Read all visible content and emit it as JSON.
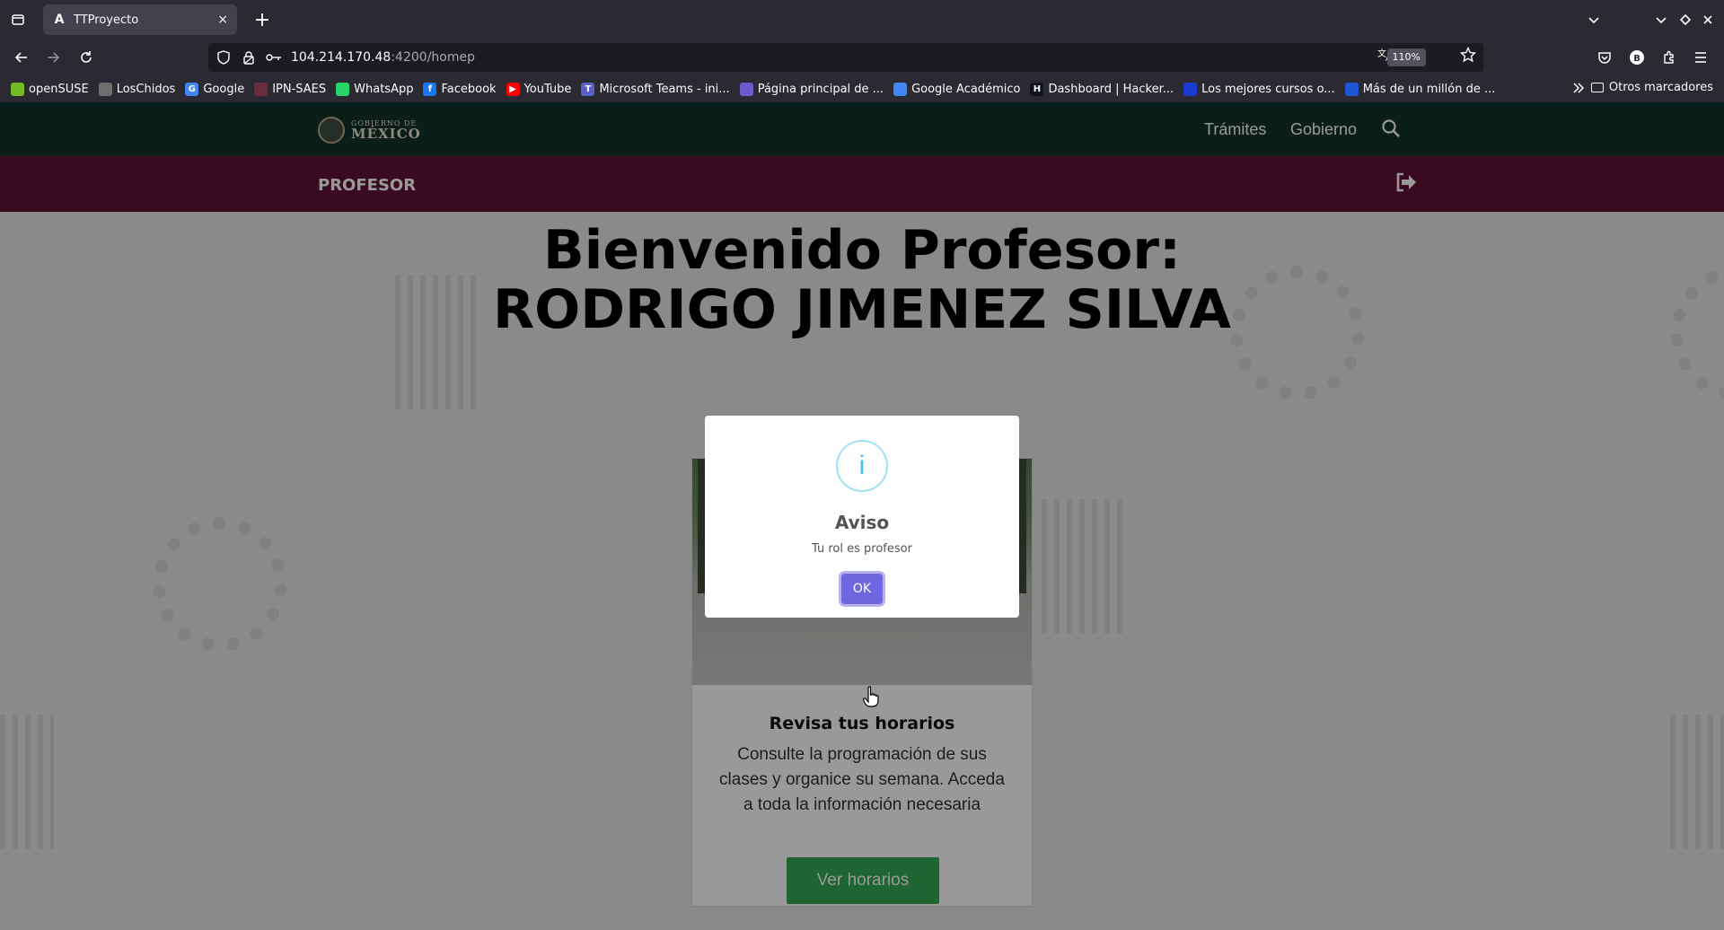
{
  "browser": {
    "tab": {
      "title": "TTProyecto",
      "favicon": "A",
      "close": "×"
    },
    "new_tab": "+",
    "url": {
      "host": "104.214.170.48",
      "rest": ":4200/homep"
    },
    "zoom": "110%",
    "bookmarks": [
      {
        "label": "openSUSE",
        "color": "#73ba25",
        "glyph": ""
      },
      {
        "label": "LosChidos",
        "color": "#6e6e6e",
        "glyph": ""
      },
      {
        "label": "Google",
        "color": "#4285f4",
        "glyph": "G"
      },
      {
        "label": "IPN-SAES",
        "color": "#6b2c3e",
        "glyph": ""
      },
      {
        "label": "WhatsApp",
        "color": "#25d366",
        "glyph": ""
      },
      {
        "label": "Facebook",
        "color": "#1877f2",
        "glyph": "f"
      },
      {
        "label": "YouTube",
        "color": "#ff0000",
        "glyph": "▶"
      },
      {
        "label": "Microsoft Teams - ini...",
        "color": "#5b5fc7",
        "glyph": "T"
      },
      {
        "label": "Página principal de ...",
        "color": "#6a5acd",
        "glyph": ""
      },
      {
        "label": "Google Académico",
        "color": "#4285f4",
        "glyph": ""
      },
      {
        "label": "Dashboard | Hacker...",
        "color": "#0e141e",
        "glyph": "H"
      },
      {
        "label": "Los mejores cursos o...",
        "color": "#1a3bd1",
        "glyph": ""
      },
      {
        "label": "Más de un millón de ...",
        "color": "#1e56d6",
        "glyph": ""
      }
    ],
    "other_bookmarks": "Otros marcadores"
  },
  "site": {
    "logo_line1": "GOBIERNO DE",
    "logo_line2": "MÉXICO",
    "nav": [
      "Trámites",
      "Gobierno"
    ],
    "role": "PROFESOR",
    "welcome_line1": "Bienvenido Profesor:",
    "welcome_line2": "RODRIGO JIMENEZ SILVA",
    "card": {
      "title": "Revisa tus horarios",
      "text": "Consulte la programación de sus clases y organice su semana. Acceda a toda la información necesaria",
      "button": "Ver horarios"
    }
  },
  "modal": {
    "icon": "i",
    "title": "Aviso",
    "text": "Tu rol es profesor",
    "ok": "OK"
  },
  "colors": {
    "gob_header": "#13322b",
    "role_bar": "#611232",
    "card_button": "#34a853",
    "modal_button": "#7066e0",
    "info_icon": "#3fc3ee"
  }
}
